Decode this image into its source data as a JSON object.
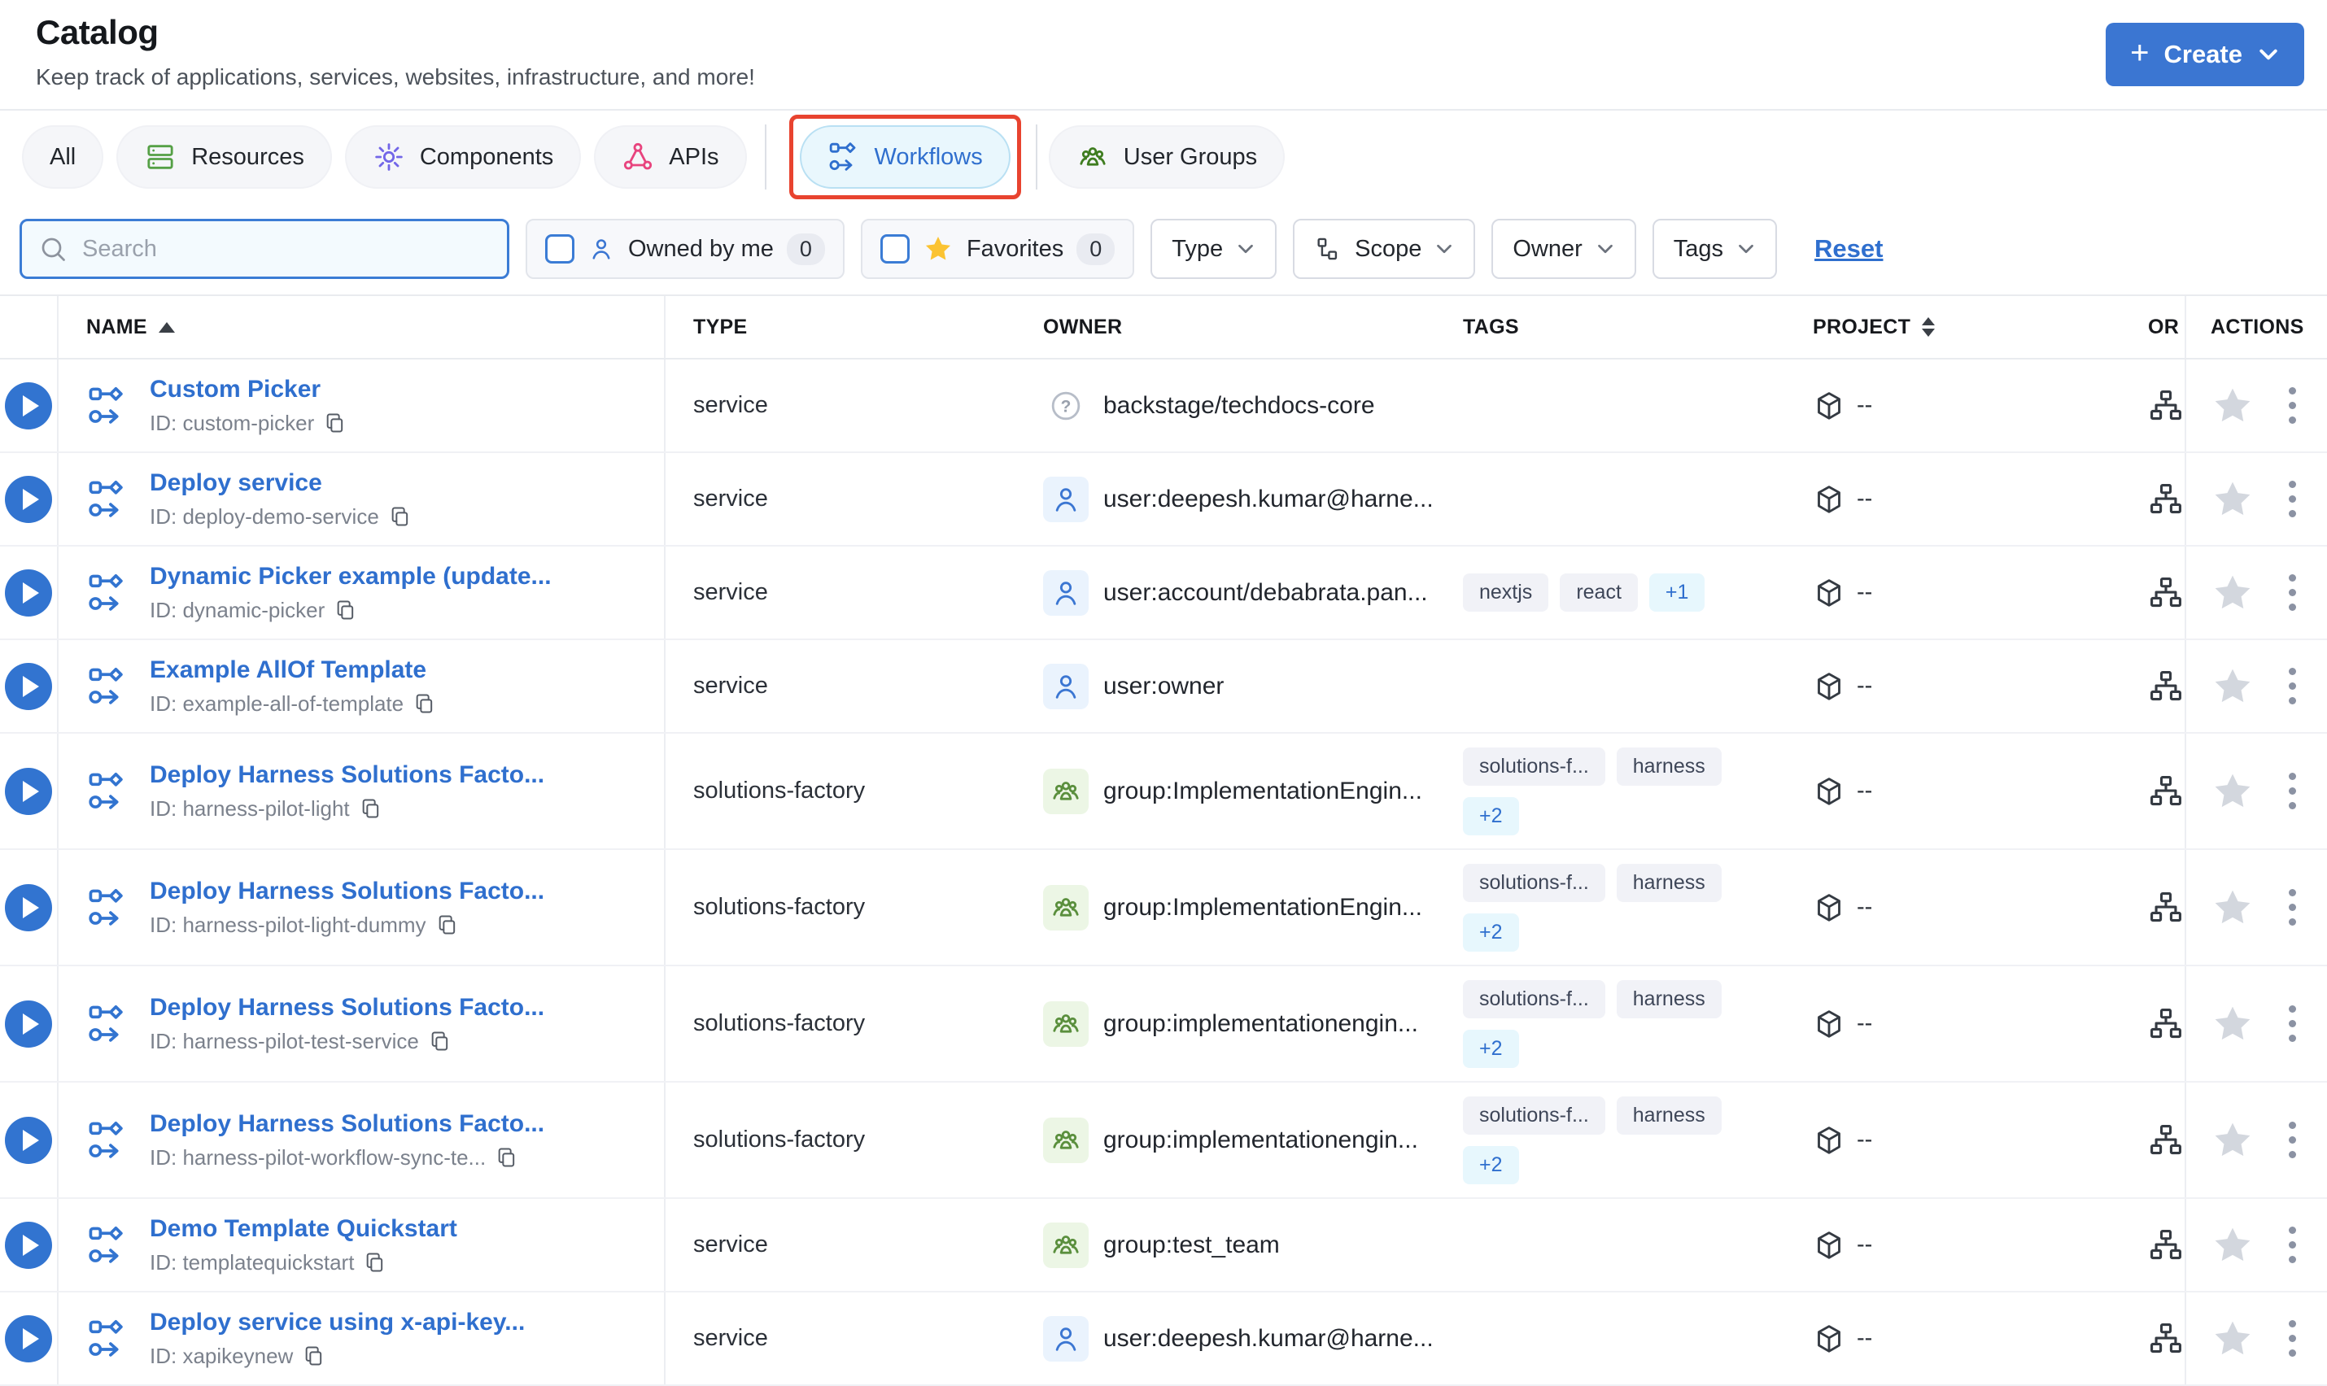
{
  "page": {
    "title": "Catalog",
    "subtitle": "Keep track of applications, services, websites, infrastructure, and more!"
  },
  "create_button": {
    "label": "Create"
  },
  "tabs": [
    {
      "id": "all",
      "label": "All",
      "icon": null,
      "icon_color": null,
      "active": false,
      "highlighted": false,
      "sep_after": false
    },
    {
      "id": "resources",
      "label": "Resources",
      "icon": "resources",
      "icon_color": "#55a046",
      "active": false,
      "highlighted": false,
      "sep_after": false
    },
    {
      "id": "components",
      "label": "Components",
      "icon": "gear",
      "icon_color": "#7266e8",
      "active": false,
      "highlighted": false,
      "sep_after": false
    },
    {
      "id": "apis",
      "label": "APIs",
      "icon": "apis",
      "icon_color": "#e8447e",
      "active": false,
      "highlighted": false,
      "sep_after": true
    },
    {
      "id": "workflows",
      "label": "Workflows",
      "icon": "workflow",
      "icon_color": "#2f6fce",
      "active": true,
      "highlighted": true,
      "sep_after": true
    },
    {
      "id": "user-groups",
      "label": "User Groups",
      "icon": "group",
      "icon_color": "#3f7d20",
      "active": false,
      "highlighted": false,
      "sep_after": false
    }
  ],
  "filters": {
    "search_placeholder": "Search",
    "owned_by_me": {
      "label": "Owned by me",
      "count": "0"
    },
    "favorites": {
      "label": "Favorites",
      "count": "0"
    },
    "dropdowns": [
      {
        "id": "type",
        "label": "Type",
        "icon": null
      },
      {
        "id": "scope",
        "label": "Scope",
        "icon": "scope"
      },
      {
        "id": "owner",
        "label": "Owner",
        "icon": null
      },
      {
        "id": "tags",
        "label": "Tags",
        "icon": null
      }
    ],
    "reset_label": "Reset"
  },
  "table": {
    "columns": {
      "name": "NAME",
      "type": "TYPE",
      "owner": "OWNER",
      "tags": "TAGS",
      "project": "PROJECT",
      "org": "OR",
      "actions": "ACTIONS"
    },
    "id_prefix": "ID: ",
    "rows": [
      {
        "name": "Custom Picker",
        "id": "custom-picker",
        "type": "service",
        "owner": {
          "kind": "unknown",
          "label": "backstage/techdocs-core"
        },
        "tags": [],
        "more": null,
        "project": "--",
        "tall": false
      },
      {
        "name": "Deploy service",
        "id": "deploy-demo-service",
        "type": "service",
        "owner": {
          "kind": "user",
          "label": "user:deepesh.kumar@harne..."
        },
        "tags": [],
        "more": null,
        "project": "--",
        "tall": false
      },
      {
        "name": "Dynamic Picker example (update...",
        "id": "dynamic-picker",
        "type": "service",
        "owner": {
          "kind": "user",
          "label": "user:account/debabrata.pan..."
        },
        "tags": [
          "nextjs",
          "react"
        ],
        "more": "+1",
        "project": "--",
        "tall": false
      },
      {
        "name": "Example AllOf Template",
        "id": "example-all-of-template",
        "type": "service",
        "owner": {
          "kind": "user",
          "label": "user:owner"
        },
        "tags": [],
        "more": null,
        "project": "--",
        "tall": false
      },
      {
        "name": "Deploy Harness Solutions Facto...",
        "id": "harness-pilot-light",
        "type": "solutions-factory",
        "owner": {
          "kind": "group",
          "label": "group:ImplementationEngin..."
        },
        "tags": [
          "solutions-f...",
          "harness"
        ],
        "more": "+2",
        "project": "--",
        "tall": true
      },
      {
        "name": "Deploy Harness Solutions Facto...",
        "id": "harness-pilot-light-dummy",
        "type": "solutions-factory",
        "owner": {
          "kind": "group",
          "label": "group:ImplementationEngin..."
        },
        "tags": [
          "solutions-f...",
          "harness"
        ],
        "more": "+2",
        "project": "--",
        "tall": true
      },
      {
        "name": "Deploy Harness Solutions Facto...",
        "id": "harness-pilot-test-service",
        "type": "solutions-factory",
        "owner": {
          "kind": "group",
          "label": "group:implementationengin..."
        },
        "tags": [
          "solutions-f...",
          "harness"
        ],
        "more": "+2",
        "project": "--",
        "tall": true
      },
      {
        "name": "Deploy Harness Solutions Facto...",
        "id": "harness-pilot-workflow-sync-te...",
        "type": "solutions-factory",
        "owner": {
          "kind": "group",
          "label": "group:implementationengin..."
        },
        "tags": [
          "solutions-f...",
          "harness"
        ],
        "more": "+2",
        "project": "--",
        "tall": true
      },
      {
        "name": "Demo Template Quickstart",
        "id": "templatequickstart",
        "type": "service",
        "owner": {
          "kind": "group",
          "label": "group:test_team"
        },
        "tags": [],
        "more": null,
        "project": "--",
        "tall": false
      },
      {
        "name": "Deploy service using x-api-key...",
        "id": "xapikeynew",
        "type": "service",
        "owner": {
          "kind": "user",
          "label": "user:deepesh.kumar@harne..."
        },
        "tags": [],
        "more": null,
        "project": "--",
        "tall": false
      }
    ]
  },
  "colors": {
    "accent": "#3274d0",
    "btn": "#3b76d2",
    "link": "#2f6fce",
    "red": "#e8432f",
    "green": "#5a8f3d",
    "chip-bg": "#f5f6f9",
    "active-bg": "#e9f7fd",
    "active-border": "#b9e0f3",
    "search-bg": "#f3fafe",
    "search-border": "#3b7cd5",
    "star-yellow": "#fbc332",
    "tag-bg": "#f1f2f7",
    "tag-text": "#3e4658",
    "more-bg": "#e7f7fd",
    "gray-star": "#d3d7de",
    "kebab": "#8b92a3",
    "border": "#e9ebef",
    "row-border": "#f0f1f5",
    "col-border": "#eceef2",
    "id-gray": "#7b818c"
  }
}
